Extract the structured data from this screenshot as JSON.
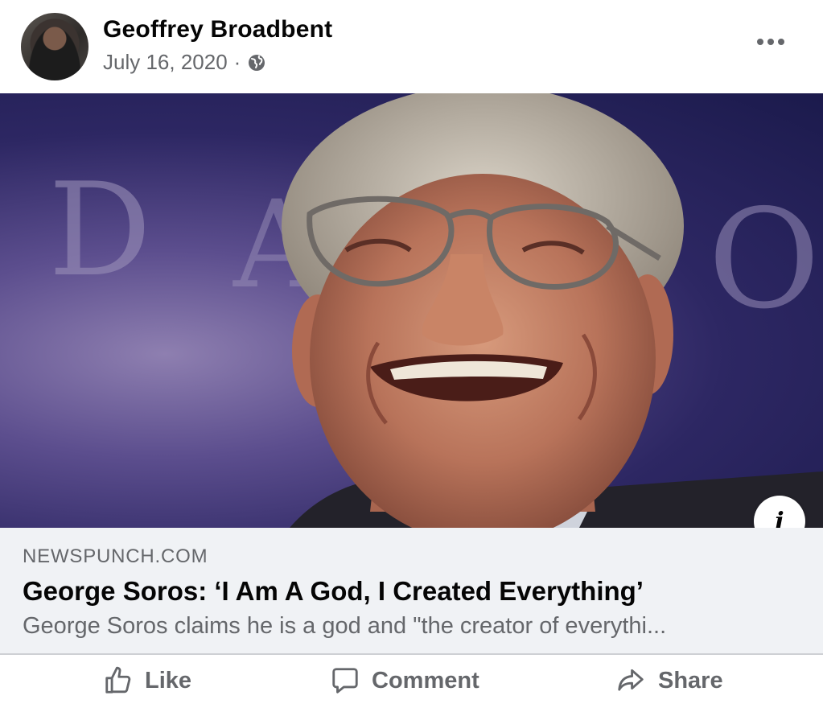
{
  "post": {
    "author": "Geoffrey Broadbent",
    "date": "July 16, 2020",
    "separator": "·",
    "privacy_icon": "globe-icon",
    "more_icon": "more-options-icon"
  },
  "image": {
    "background_letters": [
      "D",
      "A",
      "O"
    ],
    "info_icon_label": "i"
  },
  "link": {
    "domain": "NEWSPUNCH.COM",
    "headline": "George Soros: ‘I Am A God, I Created Everything’",
    "description": "George Soros claims he is a god and \"the creator of everythi..."
  },
  "actions": {
    "like": "Like",
    "comment": "Comment",
    "share": "Share"
  },
  "colors": {
    "secondary_text": "#65676b",
    "card_background": "#f0f2f5"
  }
}
